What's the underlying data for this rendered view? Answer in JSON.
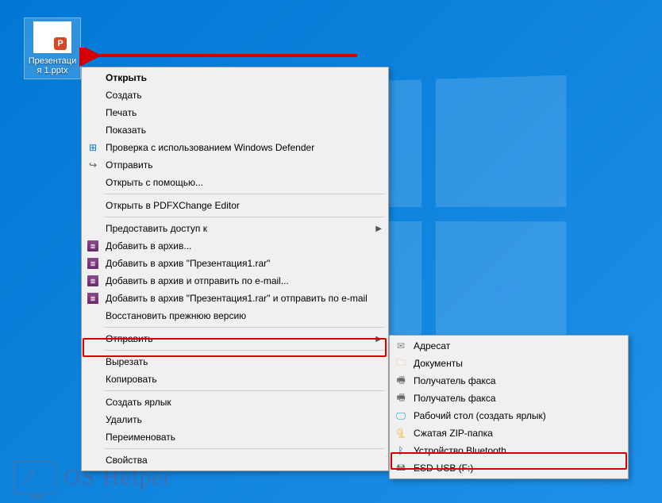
{
  "desktop": {
    "file_name": "Презентация 1.pptx"
  },
  "context_menu": {
    "open": "Открыть",
    "create": "Создать",
    "print": "Печать",
    "show": "Показать",
    "defender": "Проверка с использованием Windows Defender",
    "share": "Отправить",
    "open_with": "Открыть с помощью...",
    "pdfx": "Открыть в PDFXChange Editor",
    "grant_access": "Предоставить доступ к",
    "rar_add": "Добавить в архив...",
    "rar_add_named": "Добавить в архив \"Презентация1.rar\"",
    "rar_email": "Добавить в архив и отправить по e-mail...",
    "rar_email_named": "Добавить в архив \"Презентация1.rar\" и отправить по e-mail",
    "restore": "Восстановить прежнюю версию",
    "send_to": "Отправить",
    "cut": "Вырезать",
    "copy": "Копировать",
    "shortcut": "Создать ярлык",
    "delete": "Удалить",
    "rename": "Переименовать",
    "properties": "Свойства"
  },
  "send_to_menu": {
    "addressee": "Адресат",
    "documents": "Документы",
    "fax1": "Получатель факса",
    "fax2": "Получатель факса",
    "desktop_shortcut": "Рабочий стол (создать ярлык)",
    "zip": "Сжатая ZIP-папка",
    "bluetooth": "Устройство Bluetooth",
    "usb": "ESD-USB (F:)"
  },
  "watermark": "OS Helper"
}
